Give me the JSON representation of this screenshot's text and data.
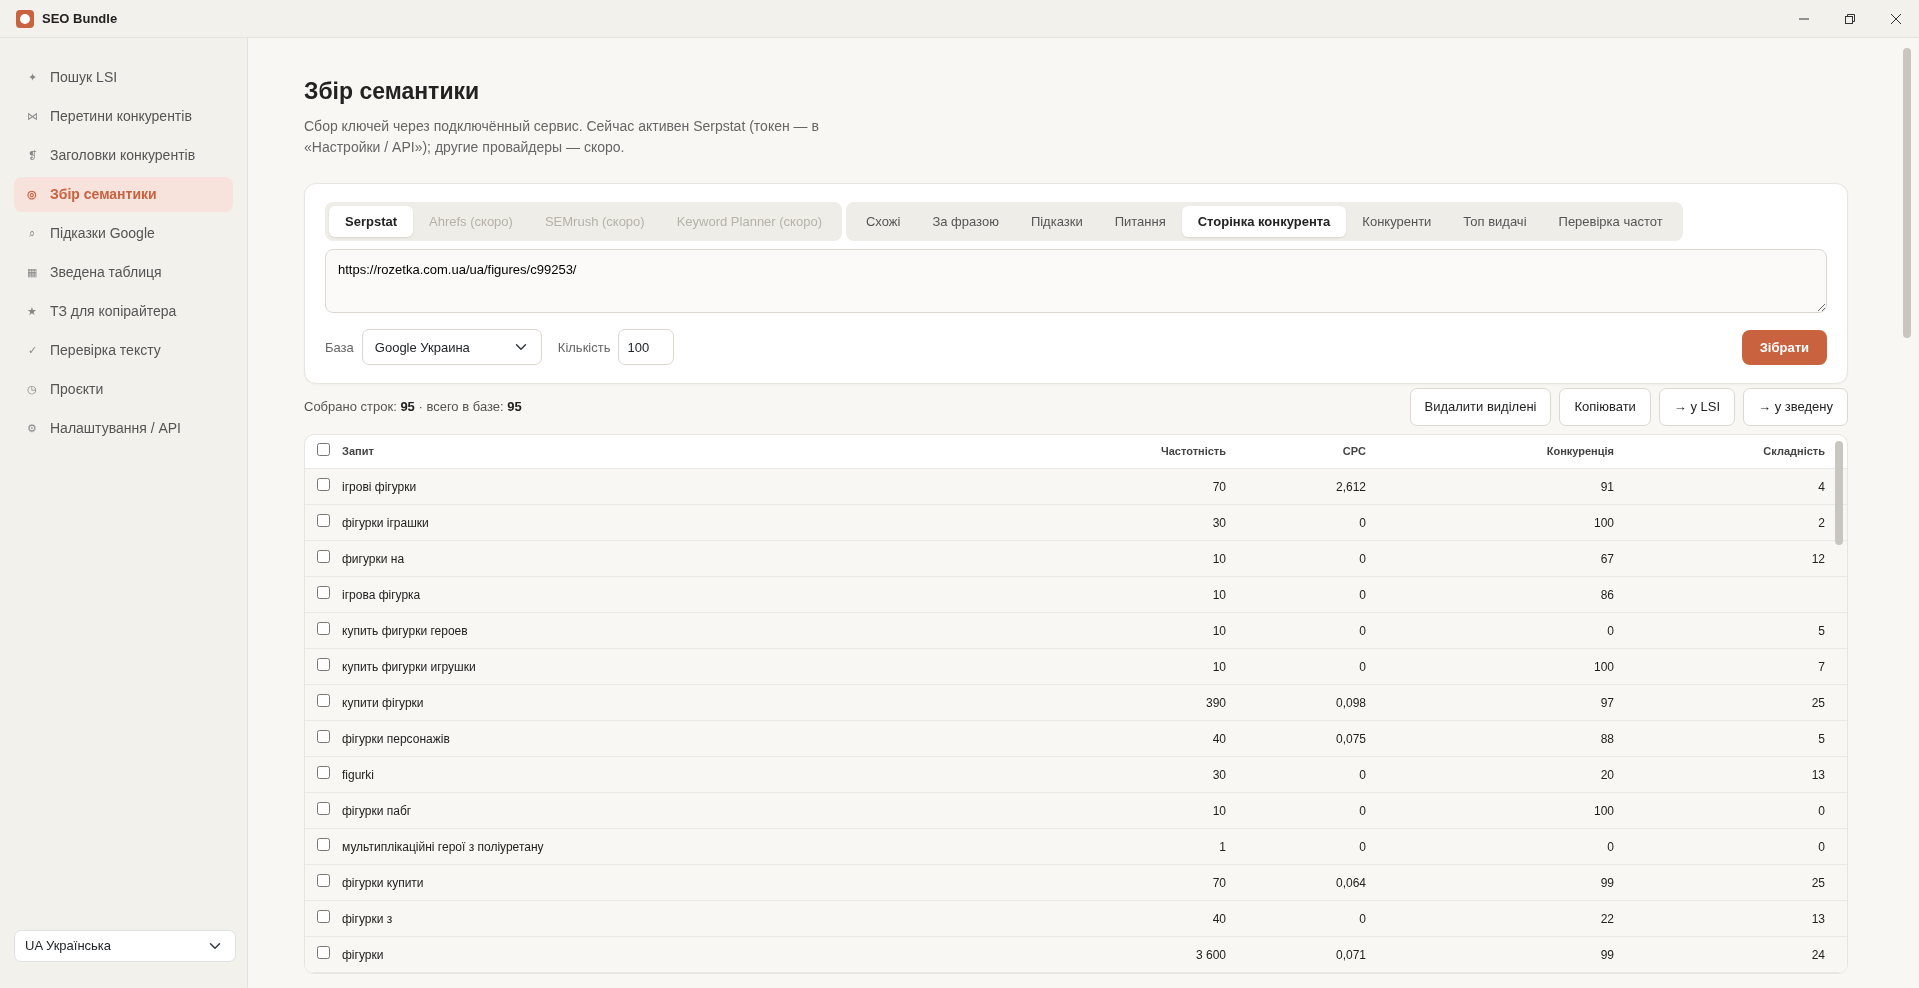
{
  "window": {
    "title": "SEO Bundle"
  },
  "sidebar": {
    "items": [
      {
        "icon": "✦",
        "label": "Пошук LSI",
        "selected": false
      },
      {
        "icon": "⋈",
        "label": "Перетини конкурентів",
        "selected": false
      },
      {
        "icon": "❡",
        "label": "Заголовки конкурентів",
        "selected": false
      },
      {
        "icon": "◎",
        "label": "Збір семантики",
        "selected": true
      },
      {
        "icon": "⌕",
        "label": "Підказки Google",
        "selected": false
      },
      {
        "icon": "▦",
        "label": "Зведена таблиця",
        "selected": false
      },
      {
        "icon": "★",
        "label": "ТЗ для копірайтера",
        "selected": false
      },
      {
        "icon": "✓",
        "label": "Перевірка тексту",
        "selected": false
      },
      {
        "icon": "◷",
        "label": "Проєкти",
        "selected": false
      },
      {
        "icon": "⚙",
        "label": "Налаштування / API",
        "selected": false
      }
    ],
    "language": {
      "flag": "UA",
      "value": "Українська"
    }
  },
  "page": {
    "title": "Збір семантики",
    "description": "Сбор ключей через подключённый сервис. Сейчас активен Serpstat (токен — в «Настройки / API»); другие провайдеры — скоро."
  },
  "provider_tabs": [
    {
      "label": "Serpstat",
      "selected": true,
      "disabled": false
    },
    {
      "label": "Ahrefs (скоро)",
      "selected": false,
      "disabled": true
    },
    {
      "label": "SEMrush (скоро)",
      "selected": false,
      "disabled": true
    },
    {
      "label": "Keyword Planner (скоро)",
      "selected": false,
      "disabled": true
    }
  ],
  "mode_tabs": [
    {
      "label": "Схожі",
      "selected": false
    },
    {
      "label": "За фразою",
      "selected": false
    },
    {
      "label": "Підказки",
      "selected": false
    },
    {
      "label": "Питання",
      "selected": false
    },
    {
      "label": "Сторінка конкурента",
      "selected": true
    },
    {
      "label": "Конкуренти",
      "selected": false
    },
    {
      "label": "Топ видачі",
      "selected": false
    },
    {
      "label": "Перевірка частот",
      "selected": false
    }
  ],
  "url_input": {
    "value": "https://rozetka.com.ua/ua/figures/c99253/"
  },
  "base": {
    "label": "База",
    "value": "Google Украина"
  },
  "count": {
    "label": "Кількість",
    "value": "100"
  },
  "collect_button": "Зібрати",
  "stats": {
    "collected_label": "Собрано строк:",
    "collected": "95",
    "total_label": "· всего в базе:",
    "total": "95"
  },
  "actions": [
    "Видалити виділені",
    "Копіювати",
    "→ у LSI",
    "→ у зведену"
  ],
  "table": {
    "select_all": {
      "checked": false
    },
    "columns": [
      "Запит",
      "Частотність",
      "CPC",
      "Конкуренція",
      "Складність"
    ],
    "rows": [
      {
        "checked": false,
        "cells": [
          "ігрові фігурки",
          "70",
          "2,612",
          "91",
          "4"
        ]
      },
      {
        "checked": false,
        "cells": [
          "фігурки іграшки",
          "30",
          "0",
          "100",
          "2"
        ]
      },
      {
        "checked": false,
        "cells": [
          "фигурки на",
          "10",
          "0",
          "67",
          "12"
        ]
      },
      {
        "checked": false,
        "cells": [
          "ігрова фігурка",
          "10",
          "0",
          "86",
          ""
        ]
      },
      {
        "checked": false,
        "cells": [
          "купить фигурки героев",
          "10",
          "0",
          "0",
          "5"
        ]
      },
      {
        "checked": false,
        "cells": [
          "купить фигурки игрушки",
          "10",
          "0",
          "100",
          "7"
        ]
      },
      {
        "checked": false,
        "cells": [
          "купити фігурки",
          "390",
          "0,098",
          "97",
          "25"
        ]
      },
      {
        "checked": false,
        "cells": [
          "фігурки персонажів",
          "40",
          "0,075",
          "88",
          "5"
        ]
      },
      {
        "checked": false,
        "cells": [
          "figurki",
          "30",
          "0",
          "20",
          "13"
        ]
      },
      {
        "checked": false,
        "cells": [
          "фігурки пабг",
          "10",
          "0",
          "100",
          "0"
        ]
      },
      {
        "checked": false,
        "cells": [
          "мультиплікаційні герої з поліуретану",
          "1",
          "0",
          "0",
          "0"
        ]
      },
      {
        "checked": false,
        "cells": [
          "фігурки купити",
          "70",
          "0,064",
          "99",
          "25"
        ]
      },
      {
        "checked": false,
        "cells": [
          "фігурки з",
          "40",
          "0",
          "22",
          "13"
        ]
      },
      {
        "checked": false,
        "cells": [
          "фігурки",
          "3 600",
          "0,071",
          "99",
          "24"
        ]
      }
    ]
  }
}
